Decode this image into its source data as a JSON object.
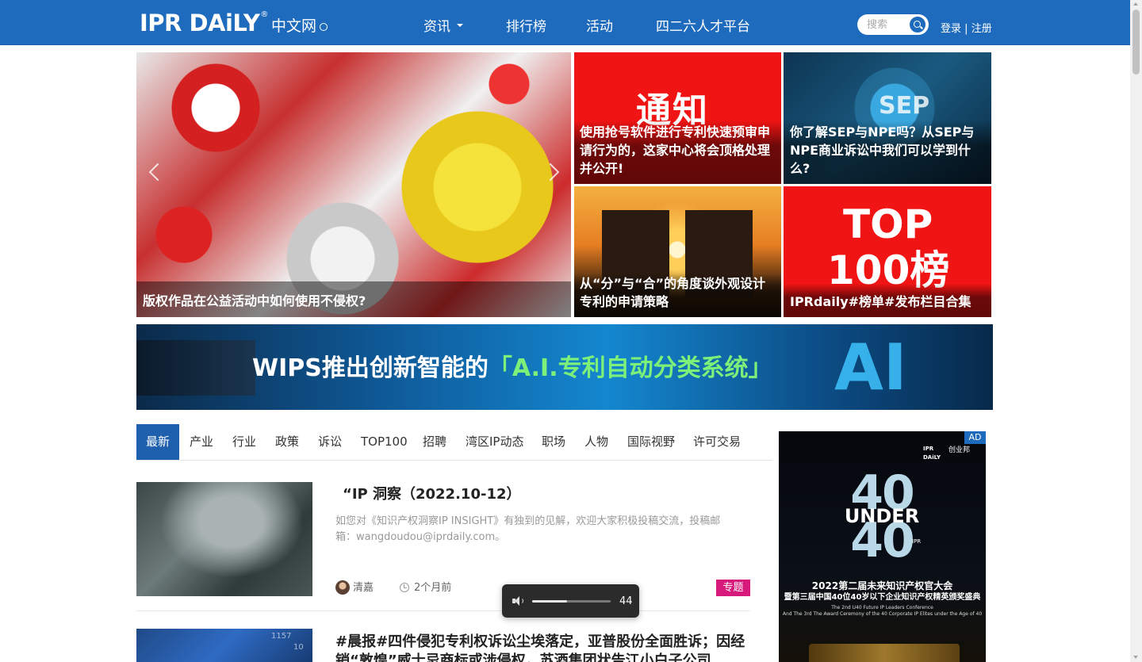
{
  "header": {
    "logo_text": "IPR DAiLY",
    "logo_reg": "®",
    "logo_cn": "中文网",
    "nav": [
      {
        "label": "资讯",
        "has_dropdown": true
      },
      {
        "label": "排行榜"
      },
      {
        "label": "活动"
      },
      {
        "label": "四二六人才平台"
      }
    ],
    "search": {
      "placeholder": "搜索",
      "icon": "search-icon"
    },
    "login": "登录",
    "separator": "|",
    "register": "注册"
  },
  "hero": {
    "main": {
      "caption": "版权作品在公益活动中如何使用不侵权?"
    },
    "tiles": [
      {
        "overlay": "通知",
        "caption": "使用抢号软件进行专利快速预审申请行为的，这家中心将会顶格处理并公开!"
      },
      {
        "overlay": "SEP",
        "caption": "你了解SEP与NPE吗？从SEP与NPE商业诉讼中我们可以学到什么?"
      },
      {
        "caption": "从“分”与“合”的角度谈外观设计专利的申请策略"
      },
      {
        "overlay_line1": "TOP",
        "overlay_line2": "100榜",
        "caption": "IPRdaily#榜单#发布栏目合集"
      }
    ]
  },
  "banner": {
    "text_prefix": "WIPS推出创新智能的",
    "text_highlight": "「A.I.专利自动分类系统」",
    "art_text": "AI"
  },
  "tabs": [
    "最新",
    "产业",
    "行业",
    "政策",
    "诉讼",
    "TOP100",
    "招聘",
    "湾区IP动态",
    "职场",
    "人物",
    "国际视野",
    "许可交易"
  ],
  "active_tab": "最新",
  "articles": [
    {
      "title": "“IP 洞察（2022.10-12）",
      "desc": "如您对《知识产权洞察IP INSIGHT》有独到的见解，欢迎大家积极投稿交流，投稿邮箱：wangdoudou@iprdaily.com。",
      "author": "清嘉",
      "time": "2个月前",
      "tag": "专题",
      "tag_color": "#d6197a"
    },
    {
      "title": "#晨报#四件侵犯专利权诉讼尘埃落定，亚普股份全面胜诉；因经销“敦煌”威士忌商标或涉侵权，苏酒集团状告江小白子公司",
      "thumb_numbers": [
        "1157",
        "10"
      ]
    }
  ],
  "volume": {
    "level": 44
  },
  "ad": {
    "badge": "AD",
    "brand_left": "IPR DAiLY",
    "brand_right": "创业邦",
    "num_top": "40",
    "under": "UNDER",
    "num_bottom": "40",
    "ipr_mark": "IPR",
    "line1": "2022第二届未来知识产权官大会",
    "line2": "暨第三届中国40位40岁以下企业知识产权精英颁奖盛典",
    "line3": "The 2nd U40 Future IP Leaders Conference",
    "line4": "And The 3rd The Award Ceremony of the 40 Corporate IP Elites under the Age of 40"
  },
  "colors": {
    "header_bg": "#1e6bbe",
    "active_tab_bg": "#1e5fae",
    "tag_bg": "#d6197a",
    "notice_red": "#f01414"
  }
}
